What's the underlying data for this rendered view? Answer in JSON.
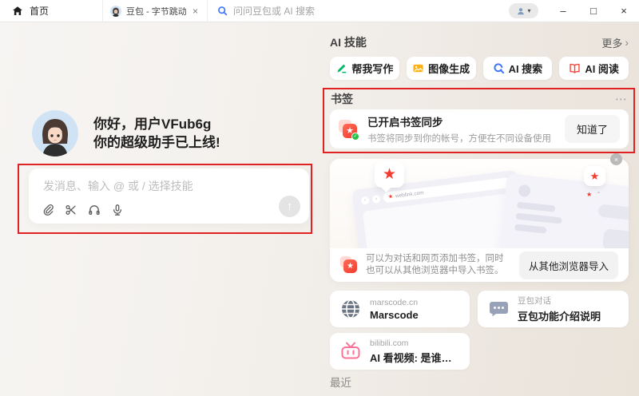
{
  "topbar": {
    "home": {
      "label": "首页"
    },
    "tab": {
      "title": "豆包 - 字节跳动旗下 AI",
      "close_icon": "×"
    },
    "search": {
      "label": "问问豆包或 AI 搜索"
    },
    "user_menu_icon": "▾",
    "window_controls": {
      "minimize": "–",
      "maximize": "□",
      "close": "×"
    }
  },
  "greeting": {
    "line1": "你好，用户VFub6g",
    "line2": "你的超级助手已上线!"
  },
  "composer": {
    "placeholder": "发消息、输入 @ 或 / 选择技能",
    "send_icon": "↑"
  },
  "skills": {
    "title": "AI 技能",
    "more_label": "更多",
    "chevron_icon": "›",
    "items": [
      {
        "label": "帮我写作",
        "icon": "pen-icon",
        "color": "#00b96b"
      },
      {
        "label": "图像生成",
        "icon": "image-icon",
        "color": "#ffb216"
      },
      {
        "label": "AI 搜索",
        "icon": "ai-search-icon",
        "color": "#3f74fd"
      },
      {
        "label": "AI 阅读",
        "icon": "book-icon",
        "color": "#f5483b"
      }
    ]
  },
  "bookmarks": {
    "title": "书签",
    "more_icon": "⋯",
    "sync_card": {
      "title": "已开启书签同步",
      "subtitle": "书签将同步到你的帐号，方便在不同设备使用",
      "confirm_label": "知道了"
    },
    "promo": {
      "close_icon": "×",
      "badge_star": "★",
      "weblink_text": "weblink.com",
      "share_icon": "⌃",
      "caption": "可以为对话和网页添加书签，同时也可以从其他浏览器中导入书签。",
      "import_label": "从其他浏览器导入"
    },
    "cards": [
      {
        "domain": "marscode.cn",
        "title": "Marscode",
        "icon": "globe-icon"
      },
      {
        "domain": "豆包对话",
        "title": "豆包功能介绍说明",
        "icon": "chat-icon"
      },
      {
        "domain": "bilibili.com",
        "title": "AI 看视频: 是谁帮我写？作...",
        "icon": "bilibili-icon"
      }
    ]
  },
  "recent": {
    "title": "最近"
  },
  "colors": {
    "accent_red": "#f23c30",
    "annotation_red": "#e02222",
    "skill_green": "#00b96b",
    "skill_orange": "#ffb216",
    "skill_blue": "#3f74fd",
    "skill_red": "#f5483b",
    "bilibili_pink": "#fb7299",
    "check_green": "#27c246"
  }
}
